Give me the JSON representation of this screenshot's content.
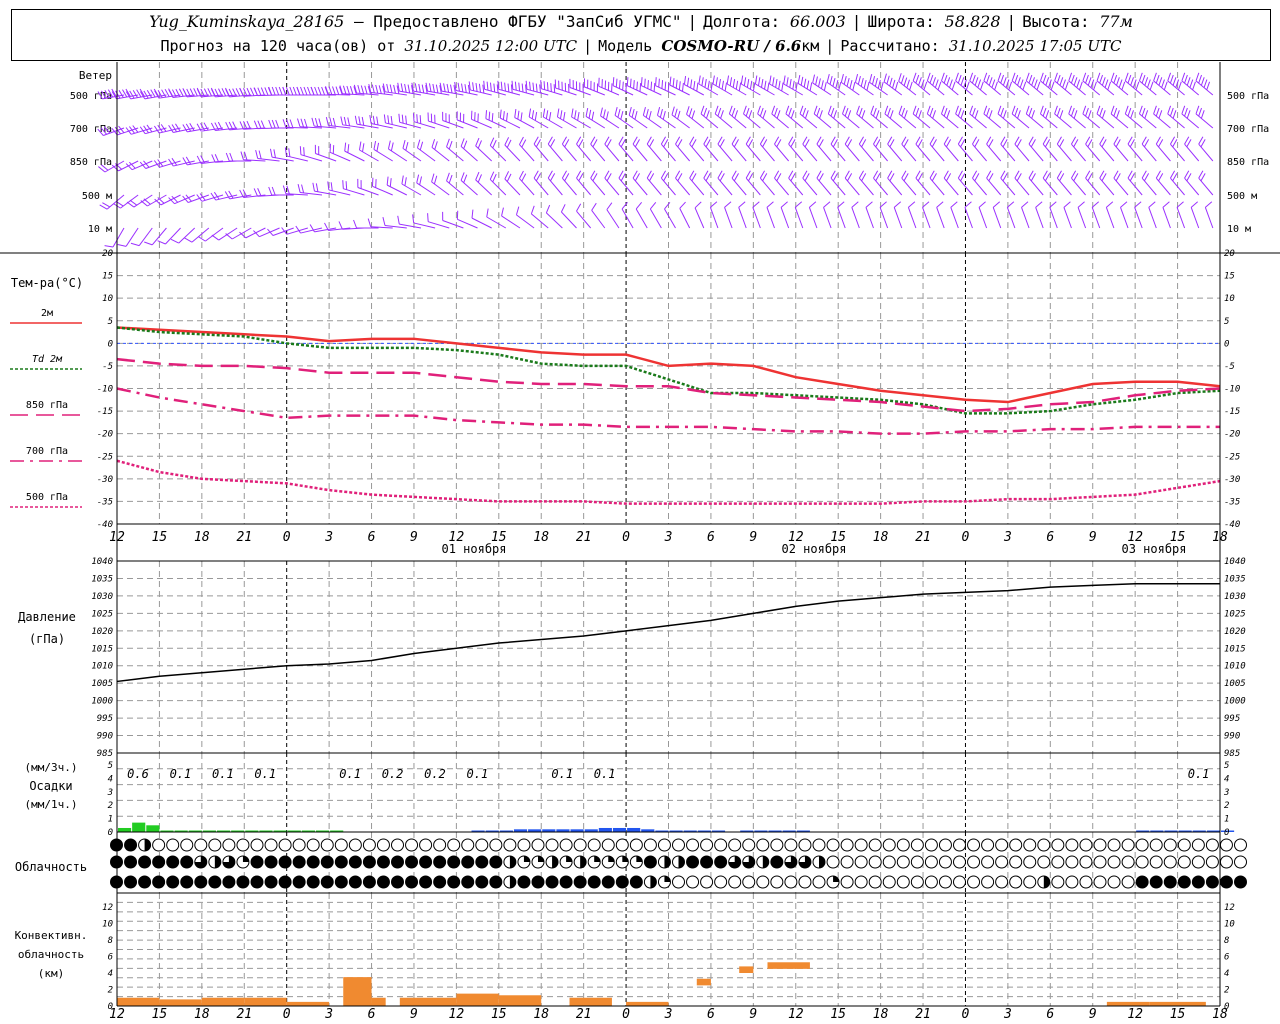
{
  "header": {
    "station": "Yug_Kuminskaya_28165",
    "dash": "—",
    "provider": "Предоставлено ФГБУ \"ЗапСиб УГМС\"",
    "lon_label": "Долгота:",
    "lon": "66.003",
    "lat_label": "Широта:",
    "lat": "58.828",
    "alt_label": "Высота:",
    "alt": "77м",
    "forecast_label": "Прогноз на 120 часа(ов) от",
    "forecast_start": "31.10.2025 12:00 UTC",
    "model_label": "Модель",
    "model": "COSMO-RU / 6.6",
    "model_unit": "км",
    "calc_label": "Рассчитано:",
    "calc_time": "31.10.2025 17:05 UTC"
  },
  "panels": {
    "wind": {
      "title": "Ветер",
      "levels": [
        "500 гПа",
        "700 гПа",
        "850 гПа",
        "500 м",
        "10 м"
      ],
      "color": "#9b30ff"
    },
    "temperature": {
      "title": "Тем-ра(°С)",
      "legend": [
        {
          "label": "2м",
          "color": "#ee3333",
          "style": "solid"
        },
        {
          "label": "Td 2м",
          "color": "#1a7a1a",
          "style": "dotted"
        },
        {
          "label": "850 гПа",
          "color": "#e0207a",
          "style": "dashed"
        },
        {
          "label": "700 гПа",
          "color": "#e0207a",
          "style": "dashdot"
        },
        {
          "label": "500 гПа",
          "color": "#e0207a",
          "style": "dotted"
        }
      ],
      "ticks": [
        "20",
        "15",
        "10",
        "5",
        "0",
        "-5",
        "-10",
        "-15",
        "-20",
        "-25",
        "-30",
        "-35",
        "-40"
      ]
    },
    "pressure": {
      "title": "Давление",
      "unit": "(гПа)",
      "ticks": [
        "1040",
        "1035",
        "1030",
        "1025",
        "1020",
        "1015",
        "1010",
        "1005",
        "1000",
        "995",
        "990",
        "985"
      ]
    },
    "precip": {
      "unit3": "(мм/3ч.)",
      "title": "Осадки",
      "unit1": "(мм/1ч.)",
      "ticks": [
        "5",
        "4",
        "3",
        "2",
        "1",
        "0"
      ],
      "amounts": [
        {
          "hour": 0,
          "text": "0.6"
        },
        {
          "hour": 3,
          "text": "0.1"
        },
        {
          "hour": 6,
          "text": "0.1"
        },
        {
          "hour": 9,
          "text": "0.1"
        },
        {
          "hour": 15,
          "text": "0.1"
        },
        {
          "hour": 18,
          "text": "0.2"
        },
        {
          "hour": 21,
          "text": "0.2"
        },
        {
          "hour": 24,
          "text": "0.1"
        },
        {
          "hour": 30,
          "text": "0.1"
        },
        {
          "hour": 33,
          "text": "0.1"
        },
        {
          "hour": 75,
          "text": "0.1"
        }
      ]
    },
    "cloud": {
      "title": "Облачность"
    },
    "convective": {
      "title1": "Конвективн.",
      "title2": "облачность",
      "unit": "(км)",
      "ticks": [
        "12",
        "10",
        "8",
        "6",
        "4",
        "2",
        "0"
      ],
      "color": "#f08a30"
    }
  },
  "time_axis": {
    "hour_labels": [
      "12",
      "15",
      "18",
      "21",
      "0",
      "3",
      "6",
      "9",
      "12",
      "15",
      "18",
      "21",
      "0",
      "3",
      "6",
      "9",
      "12",
      "15",
      "18",
      "21",
      "0",
      "3",
      "6",
      "9",
      "12",
      "15",
      "18"
    ],
    "day_labels": [
      "01 ноября",
      "02 ноября",
      "03 ноября"
    ]
  },
  "chart_data": {
    "type": "line",
    "x_unit": "hours since 31.10.2025 12:00 UTC",
    "x": [
      0,
      3,
      6,
      9,
      12,
      15,
      18,
      21,
      24,
      27,
      30,
      33,
      36,
      39,
      42,
      45,
      48,
      51,
      54,
      57,
      60,
      63,
      66,
      69,
      72,
      75,
      78
    ],
    "series": [
      {
        "name": "2м",
        "values": [
          3.5,
          3.0,
          2.5,
          2.0,
          1.5,
          0.5,
          1.0,
          1.0,
          0.0,
          -1.0,
          -2.0,
          -2.5,
          -2.5,
          -5.0,
          -4.5,
          -5.0,
          -7.5,
          -9.0,
          -10.5,
          -11.5,
          -12.5,
          -13.0,
          -11.0,
          -9.0,
          -8.5,
          -8.5,
          -9.5
        ]
      },
      {
        "name": "Td 2м",
        "values": [
          3.5,
          2.5,
          2.0,
          1.5,
          0.0,
          -1.0,
          -1.0,
          -1.0,
          -1.5,
          -2.5,
          -4.5,
          -5.0,
          -5.0,
          -8.0,
          -11.0,
          -11.0,
          -11.5,
          -12.0,
          -12.5,
          -13.5,
          -15.5,
          -15.5,
          -15.0,
          -13.5,
          -12.5,
          -11.0,
          -10.5
        ]
      },
      {
        "name": "850 гПа",
        "values": [
          -3.5,
          -4.5,
          -5.0,
          -5.0,
          -5.5,
          -6.5,
          -6.5,
          -6.5,
          -7.5,
          -8.5,
          -9.0,
          -9.0,
          -9.5,
          -9.5,
          -11.0,
          -11.5,
          -12.0,
          -12.5,
          -13.0,
          -14.0,
          -15.0,
          -14.5,
          -13.5,
          -13.0,
          -11.5,
          -10.5,
          -10.0
        ]
      },
      {
        "name": "700 гПа",
        "values": [
          -10.0,
          -12.0,
          -13.5,
          -15.0,
          -16.5,
          -16.0,
          -16.0,
          -16.0,
          -17.0,
          -17.5,
          -18.0,
          -18.0,
          -18.5,
          -18.5,
          -18.5,
          -19.0,
          -19.5,
          -19.5,
          -20.0,
          -20.0,
          -19.5,
          -19.5,
          -19.0,
          -19.0,
          -18.5,
          -18.5,
          -18.5
        ]
      },
      {
        "name": "500 гПа",
        "values": [
          -26.0,
          -28.5,
          -30.0,
          -30.5,
          -31.0,
          -32.5,
          -33.5,
          -34.0,
          -34.5,
          -35.0,
          -35.0,
          -35.0,
          -35.5,
          -35.5,
          -35.5,
          -35.5,
          -35.5,
          -35.5,
          -35.5,
          -35.0,
          -35.0,
          -34.5,
          -34.5,
          -34.0,
          -33.5,
          -32.0,
          -30.5
        ]
      }
    ],
    "pressure": {
      "name": "Давление",
      "values": [
        1005.5,
        1007.0,
        1008.0,
        1009.0,
        1010.0,
        1010.5,
        1011.5,
        1013.5,
        1015.0,
        1016.5,
        1017.5,
        1018.5,
        1020.0,
        1021.5,
        1023.0,
        1025.0,
        1027.0,
        1028.5,
        1029.5,
        1030.5,
        1031.0,
        1031.5,
        1032.5,
        1033.0,
        1033.5,
        1033.5,
        1033.5
      ],
      "ylim": [
        985,
        1040
      ]
    },
    "ylim": [
      -40,
      20
    ],
    "precip_hourly_mm": [
      0.3,
      0.7,
      0.5,
      0.1,
      0.1,
      0.1,
      0.1,
      0.1,
      0.1,
      0.1,
      0.1,
      0.1,
      0.1,
      0.1,
      0.1,
      0.05,
      0,
      0,
      0,
      0,
      0,
      0,
      0,
      0,
      0,
      0.05,
      0.05,
      0.1,
      0.2,
      0.2,
      0.2,
      0.2,
      0.2,
      0.2,
      0.3,
      0.3,
      0.3,
      0.2,
      0.05,
      0.05,
      0.05,
      0.05,
      0.05,
      0,
      0.05,
      0.05,
      0.05,
      0.05,
      0.05,
      0,
      0,
      0,
      0,
      0,
      0,
      0,
      0,
      0,
      0,
      0,
      0,
      0,
      0,
      0,
      0,
      0,
      0,
      0,
      0,
      0,
      0,
      0,
      0.05,
      0.05,
      0.05,
      0.05,
      0.05,
      0.05,
      0.05
    ],
    "precip_colors": {
      "rain": "#22cc22",
      "snow": "#2255ee"
    },
    "convective_segments_km": [
      {
        "from": 0,
        "to": 3,
        "base": 0,
        "top": 1.0
      },
      {
        "from": 3,
        "to": 6,
        "base": 0,
        "top": 0.8
      },
      {
        "from": 6,
        "to": 9,
        "base": 0,
        "top": 1.0
      },
      {
        "from": 9,
        "to": 12,
        "base": 0,
        "top": 1.0
      },
      {
        "from": 12,
        "to": 15,
        "base": 0,
        "top": 0.5
      },
      {
        "from": 16,
        "to": 18,
        "base": 0,
        "top": 3.5
      },
      {
        "from": 18,
        "to": 19,
        "base": 0,
        "top": 1.0
      },
      {
        "from": 20,
        "to": 24,
        "base": 0,
        "top": 1.0
      },
      {
        "from": 24,
        "to": 27,
        "base": 0,
        "top": 1.5
      },
      {
        "from": 27,
        "to": 30,
        "base": 0,
        "top": 1.3
      },
      {
        "from": 32,
        "to": 35,
        "base": 0,
        "top": 1.0
      },
      {
        "from": 36,
        "to": 39,
        "base": 0,
        "top": 0.5
      },
      {
        "from": 41,
        "to": 42,
        "base": 2.5,
        "top": 3.3
      },
      {
        "from": 44,
        "to": 45,
        "base": 4.0,
        "top": 4.8
      },
      {
        "from": 46,
        "to": 49,
        "base": 4.5,
        "top": 5.3
      },
      {
        "from": 70,
        "to": 73,
        "base": 0,
        "top": 0.5
      },
      {
        "from": 73,
        "to": 77,
        "base": 0,
        "top": 0.5
      }
    ],
    "cloud_cover_okta": {
      "high": [
        8,
        8,
        4,
        0,
        0,
        0,
        0,
        0,
        0,
        0,
        0,
        0,
        0,
        0,
        0,
        0,
        0,
        0,
        0,
        0,
        0,
        0,
        0,
        0,
        0,
        0,
        0,
        0,
        0,
        0,
        0,
        0,
        0,
        0,
        0,
        0,
        0,
        0,
        0,
        0,
        0,
        0,
        0,
        0,
        0,
        0,
        0,
        0,
        0,
        0,
        0,
        0,
        0,
        0,
        0,
        0,
        0,
        0,
        0,
        0,
        0,
        0,
        0,
        0,
        0,
        0,
        0,
        0,
        0,
        0,
        0,
        0,
        0,
        0,
        0,
        0,
        0,
        0,
        0,
        0,
        0
      ],
      "middle": [
        8,
        8,
        8,
        8,
        8,
        8,
        6,
        4,
        6,
        2,
        8,
        8,
        8,
        8,
        8,
        8,
        8,
        8,
        8,
        8,
        8,
        8,
        8,
        8,
        8,
        8,
        8,
        8,
        4,
        2,
        2,
        4,
        2,
        4,
        2,
        2,
        2,
        2,
        8,
        4,
        4,
        8,
        8,
        8,
        6,
        6,
        4,
        8,
        6,
        6,
        4,
        0,
        0,
        0,
        0,
        0,
        0,
        0,
        0,
        0,
        0,
        0,
        0,
        0,
        0,
        0,
        0,
        0,
        0,
        0,
        0,
        0,
        0,
        0,
        0,
        0,
        0,
        0,
        0,
        0,
        0
      ],
      "low": [
        8,
        8,
        8,
        8,
        8,
        8,
        8,
        8,
        8,
        8,
        8,
        8,
        8,
        8,
        8,
        8,
        8,
        8,
        8,
        8,
        8,
        8,
        8,
        8,
        8,
        8,
        8,
        8,
        4,
        8,
        8,
        8,
        8,
        8,
        8,
        8,
        8,
        8,
        4,
        2,
        0,
        0,
        0,
        0,
        0,
        0,
        0,
        0,
        0,
        0,
        0,
        2,
        0,
        0,
        0,
        0,
        0,
        0,
        0,
        0,
        0,
        0,
        0,
        0,
        0,
        0,
        4,
        0,
        0,
        0,
        0,
        0,
        0,
        8,
        8,
        8,
        8,
        8,
        8,
        8,
        8
      ]
    },
    "wind_direction_deg": {
      "500 гПа": [
        260,
        260,
        265,
        265,
        270,
        270,
        275,
        280,
        280,
        285,
        285,
        290,
        295,
        295,
        300,
        300,
        300,
        305,
        305,
        310,
        310,
        310,
        310,
        310,
        310,
        310,
        310
      ],
      "700 гПа": [
        250,
        255,
        260,
        265,
        270,
        275,
        280,
        285,
        290,
        295,
        300,
        300,
        305,
        305,
        310,
        310,
        310,
        310,
        310,
        310,
        310,
        310,
        310,
        310,
        310,
        310,
        310
      ],
      "850 гПа": [
        240,
        250,
        260,
        270,
        280,
        290,
        300,
        305,
        310,
        315,
        320,
        320,
        320,
        320,
        320,
        320,
        320,
        320,
        320,
        320,
        320,
        320,
        320,
        320,
        320,
        320,
        320
      ],
      "500 м": [
        230,
        240,
        250,
        260,
        270,
        280,
        290,
        300,
        310,
        315,
        320,
        320,
        320,
        320,
        320,
        320,
        320,
        320,
        320,
        320,
        320,
        320,
        320,
        320,
        320,
        320,
        320
      ],
      "10 м": [
        210,
        220,
        230,
        240,
        250,
        260,
        270,
        280,
        290,
        300,
        310,
        320,
        330,
        330,
        340,
        340,
        340,
        340,
        340,
        340,
        340,
        340,
        340,
        340,
        340,
        340,
        340
      ]
    },
    "wind_speed_ms": {
      "500 гПа": [
        25,
        25,
        25,
        25,
        25,
        25,
        25,
        25,
        25,
        25,
        25,
        25,
        25,
        25,
        25,
        25,
        25,
        25,
        25,
        25,
        25,
        25,
        25,
        25,
        25,
        25,
        25
      ],
      "700 гПа": [
        15,
        15,
        15,
        15,
        15,
        15,
        15,
        15,
        15,
        15,
        15,
        15,
        15,
        15,
        15,
        15,
        15,
        15,
        15,
        15,
        15,
        15,
        15,
        15,
        15,
        15,
        15
      ],
      "850 гПа": [
        10,
        10,
        10,
        10,
        10,
        10,
        10,
        10,
        10,
        10,
        10,
        10,
        10,
        10,
        10,
        10,
        10,
        10,
        10,
        10,
        10,
        10,
        10,
        10,
        10,
        10,
        10
      ],
      "500 м": [
        8,
        8,
        8,
        8,
        8,
        8,
        8,
        8,
        8,
        8,
        8,
        8,
        8,
        8,
        8,
        8,
        8,
        8,
        8,
        8,
        8,
        8,
        8,
        8,
        8,
        8,
        8
      ],
      "10 м": [
        4,
        4,
        4,
        4,
        4,
        4,
        4,
        4,
        4,
        4,
        4,
        4,
        4,
        4,
        4,
        4,
        4,
        4,
        4,
        4,
        4,
        4,
        4,
        4,
        4,
        4,
        4
      ]
    }
  }
}
